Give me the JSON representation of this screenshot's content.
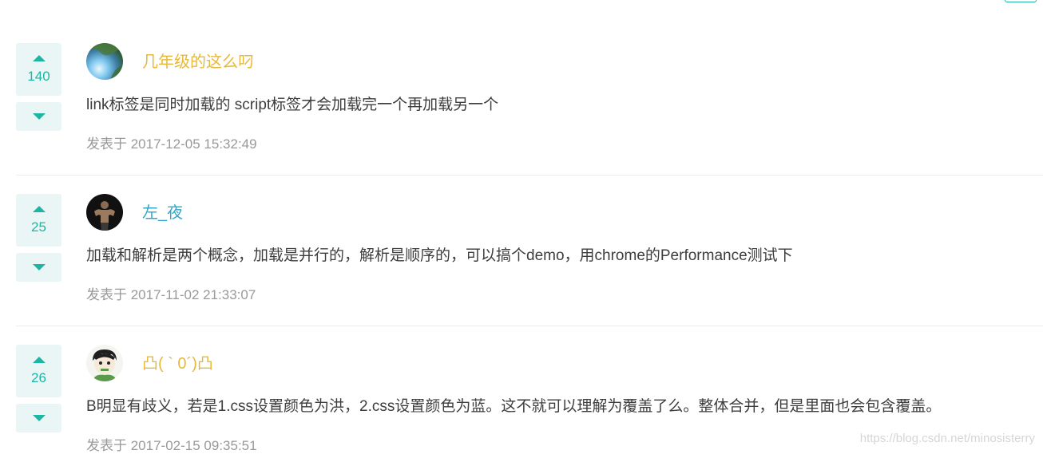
{
  "colors": {
    "accent": "#1fb5a3",
    "vote_bg": "#eaf6f5",
    "username_gold": "#e8b839",
    "username_blue": "#30a6c8",
    "text": "#3d3d3d",
    "meta": "#999999"
  },
  "comments": [
    {
      "votes": "140",
      "username": "几年级的这么叼",
      "username_color": "#e8b839",
      "avatar": "landscape-avatar",
      "text": "link标签是同时加载的 script标签才会加载完一个再加载另一个",
      "meta": "发表于 2017-12-05 15:32:49"
    },
    {
      "votes": "25",
      "username": "左_夜",
      "username_color": "#30a6c8",
      "avatar": "muscle-figure-avatar",
      "text": "加载和解析是两个概念，加载是并行的，解析是顺序的，可以搞个demo，用chrome的Performance测试下",
      "meta": "发表于 2017-11-02 21:33:07"
    },
    {
      "votes": "26",
      "username": "凸( ` 0´)凸",
      "username_color": "#e8b839",
      "avatar": "cartoon-boy-avatar",
      "text": "B明显有歧义，若是1.css设置颜色为洪，2.css设置颜色为蓝。这不就可以理解为覆盖了么。整体合并，但是里面也会包含覆盖。",
      "meta": "发表于 2017-02-15 09:35:51"
    }
  ],
  "watermark": "https://blog.csdn.net/minosisterry"
}
